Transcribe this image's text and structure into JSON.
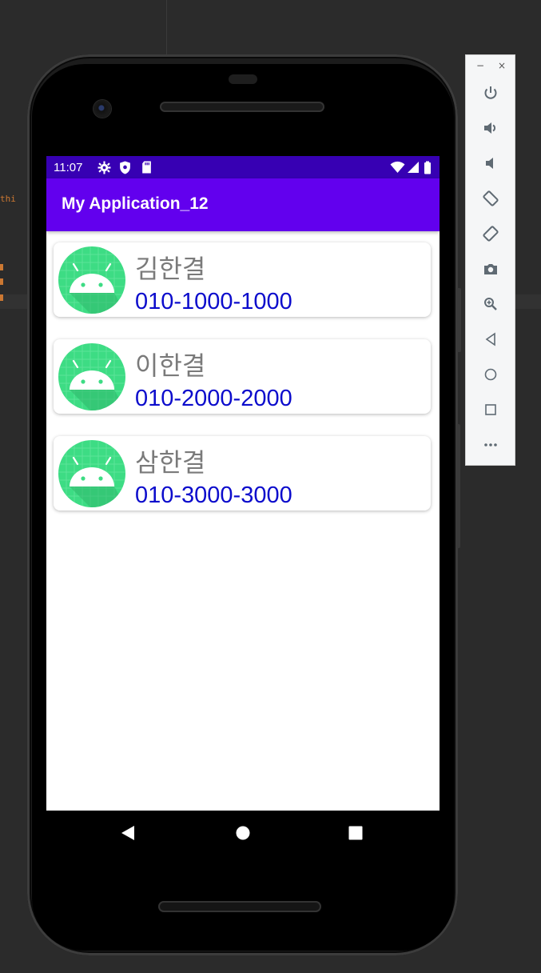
{
  "ide": {
    "code_fragment": "thi"
  },
  "emulator_toolbar": {
    "minimize_label": "−",
    "close_label": "×",
    "buttons": [
      {
        "icon": "power-icon"
      },
      {
        "icon": "volume-up-icon"
      },
      {
        "icon": "volume-down-icon"
      },
      {
        "icon": "rotate-left-icon"
      },
      {
        "icon": "rotate-right-icon"
      },
      {
        "icon": "camera-icon"
      },
      {
        "icon": "zoom-icon"
      },
      {
        "icon": "back-icon"
      },
      {
        "icon": "home-icon"
      },
      {
        "icon": "overview-icon"
      },
      {
        "icon": "more-icon"
      }
    ]
  },
  "status_bar": {
    "time": "11:07",
    "left_icons": [
      "settings-icon",
      "shield-icon",
      "sd-card-icon"
    ],
    "right_icons": [
      "wifi-icon",
      "signal-icon",
      "battery-icon"
    ]
  },
  "app_bar": {
    "title": "My Application_12"
  },
  "contacts": [
    {
      "name": "김한결",
      "phone": "010-1000-1000"
    },
    {
      "name": "이한결",
      "phone": "010-2000-2000"
    },
    {
      "name": "삼한결",
      "phone": "010-3000-3000"
    }
  ],
  "colors": {
    "status_bar": "#3700b3",
    "app_bar": "#6200ee",
    "phone_text": "#0c0ccc",
    "name_text": "#7a7a7a",
    "avatar_bg": "#3ddc84"
  },
  "nav_bar": {
    "buttons": [
      "nav-back-icon",
      "nav-home-icon",
      "nav-recents-icon"
    ]
  }
}
